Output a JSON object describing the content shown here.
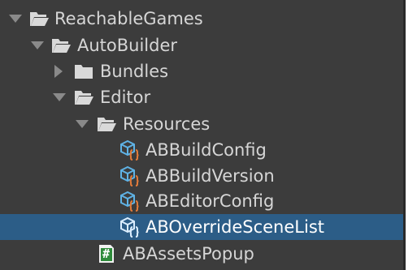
{
  "tree": {
    "items": [
      {
        "label": "ReachableGames",
        "icon": "folder-open-icon",
        "expanded": true
      },
      {
        "label": "AutoBuilder",
        "icon": "folder-open-icon",
        "expanded": true
      },
      {
        "label": "Bundles",
        "icon": "folder-closed-icon",
        "expanded": false
      },
      {
        "label": "Editor",
        "icon": "folder-open-icon",
        "expanded": true
      },
      {
        "label": "Resources",
        "icon": "folder-open-icon",
        "expanded": true
      },
      {
        "label": "ABBuildConfig",
        "icon": "scriptable-object-icon"
      },
      {
        "label": "ABBuildVersion",
        "icon": "scriptable-object-icon"
      },
      {
        "label": "ABEditorConfig",
        "icon": "scriptable-object-icon"
      },
      {
        "label": "ABOverrideSceneList",
        "icon": "scriptable-object-icon",
        "selected": true
      },
      {
        "label": "ABAssetsPopup",
        "icon": "csharp-script-icon",
        "glyph": "#"
      }
    ]
  },
  "colors": {
    "background": "#3c3c3c",
    "selection": "#2c5d87",
    "text": "#d6d6d6",
    "selected_text": "#ffffff",
    "script_icon": "#2e8b3a",
    "so_icon_cube": "#5fb3e6",
    "so_icon_brace": "#e07a3a"
  }
}
